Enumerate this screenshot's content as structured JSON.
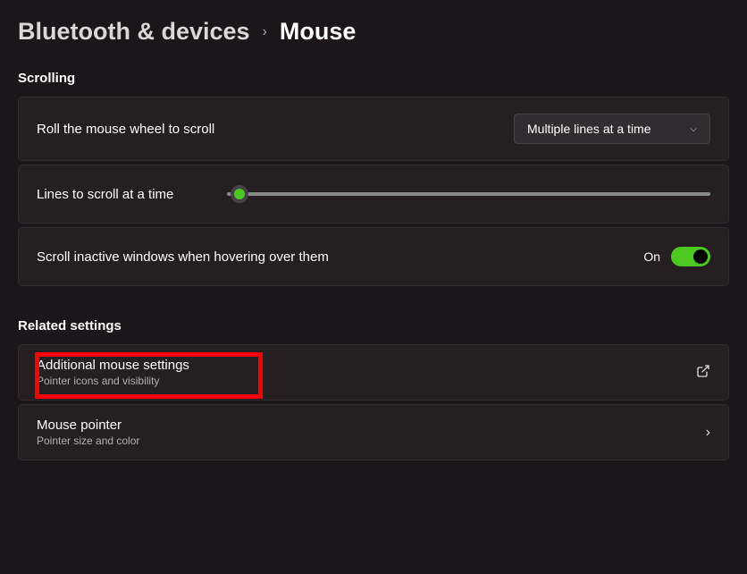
{
  "breadcrumb": {
    "parent": "Bluetooth & devices",
    "current": "Mouse"
  },
  "sections": {
    "scrolling": {
      "header": "Scrolling",
      "wheel_scroll": {
        "label": "Roll the mouse wheel to scroll",
        "value": "Multiple lines at a time"
      },
      "lines_scroll": {
        "label": "Lines to scroll at a time",
        "slider_value": 3,
        "slider_min": 1,
        "slider_max": 100
      },
      "inactive_scroll": {
        "label": "Scroll inactive windows when hovering over them",
        "state_label": "On",
        "state": true
      }
    },
    "related": {
      "header": "Related settings",
      "additional": {
        "title": "Additional mouse settings",
        "subtitle": "Pointer icons and visibility"
      },
      "pointer": {
        "title": "Mouse pointer",
        "subtitle": "Pointer size and color"
      }
    }
  }
}
